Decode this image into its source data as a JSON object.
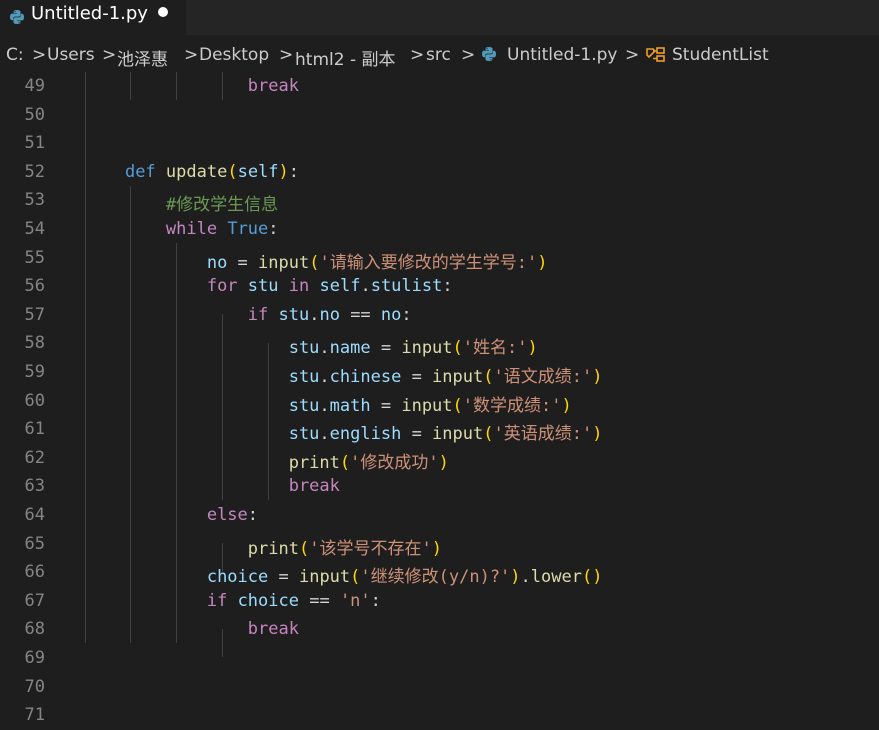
{
  "tab": {
    "title": "Untitled-1.py",
    "icon": "python-icon",
    "dirty": true
  },
  "breadcrumb": {
    "items": [
      "C:",
      "Users",
      "池泽惠",
      "Desktop",
      "html2 - 副本",
      "src",
      "Untitled-1.py",
      "StudentList"
    ],
    "separator": ">"
  },
  "editor": {
    "lines": [
      {
        "n": "49",
        "t": "                break"
      },
      {
        "n": "50",
        "t": ""
      },
      {
        "n": "51",
        "t": ""
      },
      {
        "n": "52",
        "t": "    def update(self):"
      },
      {
        "n": "53",
        "t": "        #修改学生信息"
      },
      {
        "n": "54",
        "t": "        while True:"
      },
      {
        "n": "55",
        "t": "            no = input('请输入要修改的学生学号:')"
      },
      {
        "n": "56",
        "t": "            for stu in self.stulist:"
      },
      {
        "n": "57",
        "t": "                if stu.no == no:"
      },
      {
        "n": "58",
        "t": "                    stu.name = input('姓名:')"
      },
      {
        "n": "59",
        "t": "                    stu.chinese = input('语文成绩:')"
      },
      {
        "n": "60",
        "t": "                    stu.math = input('数学成绩:')"
      },
      {
        "n": "61",
        "t": "                    stu.english = input('英语成绩:')"
      },
      {
        "n": "62",
        "t": "                    print('修改成功')"
      },
      {
        "n": "63",
        "t": "                    break"
      },
      {
        "n": "64",
        "t": "            else:"
      },
      {
        "n": "65",
        "t": "                print('该学号不存在')"
      },
      {
        "n": "66",
        "t": "            choice = input('继续修改(y/n)?').lower()"
      },
      {
        "n": "67",
        "t": "            if choice == 'n':"
      },
      {
        "n": "68",
        "t": "                break"
      },
      {
        "n": "69",
        "t": ""
      },
      {
        "n": "70",
        "t": ""
      },
      {
        "n": "71",
        "t": ""
      }
    ]
  },
  "colors": {
    "background": "#1e1e1e",
    "keyword": "#c586c0",
    "def_keyword": "#569cd6",
    "function": "#dcdcaa",
    "variable": "#9cdcfe",
    "string": "#ce9178",
    "comment": "#6a9955",
    "line_number": "#858585"
  }
}
